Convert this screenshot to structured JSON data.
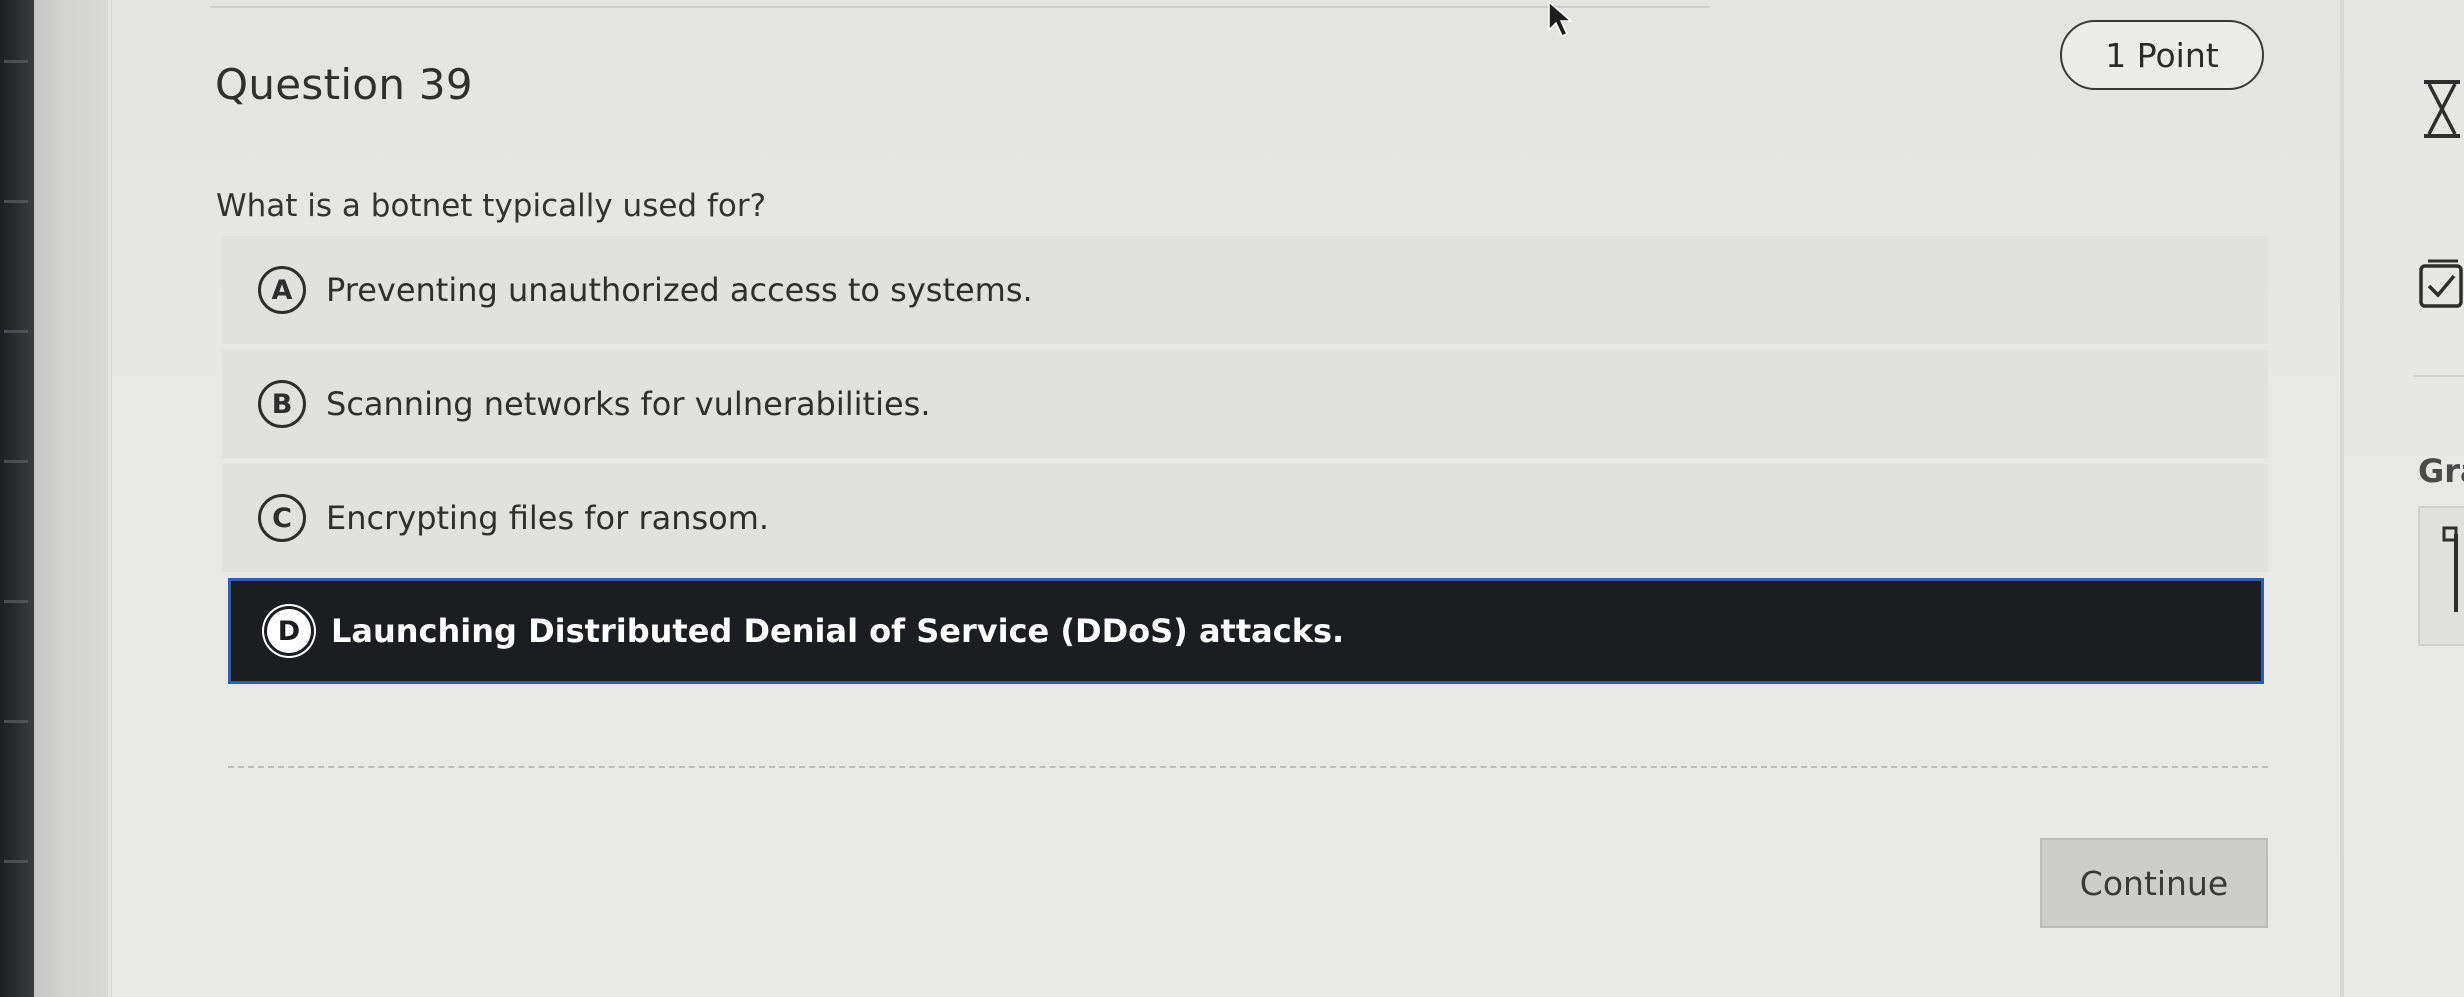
{
  "question": {
    "title": "Question 39",
    "points": "1 Point",
    "prompt": "What is a botnet typically used for?"
  },
  "options": [
    {
      "letter": "A",
      "text": "Preventing unauthorized access to systems.",
      "selected": false
    },
    {
      "letter": "B",
      "text": "Scanning networks for vulnerabilities.",
      "selected": false
    },
    {
      "letter": "C",
      "text": "Encrypting files for ransom.",
      "selected": false
    },
    {
      "letter": "D",
      "text": "Launching Distributed Denial of Service (DDoS) attacks.",
      "selected": true
    }
  ],
  "footer": {
    "continue_label": "Continue"
  },
  "side_panel": {
    "partial_label": "Gra",
    "icons": [
      "hourglass-icon",
      "checklist-icon",
      "pencil-icon"
    ]
  },
  "colors": {
    "selected_background": "#1c1d20",
    "selected_border": "#2b5fb0",
    "card_background": "#e8e8e6",
    "option_background": "#e1e1df"
  }
}
